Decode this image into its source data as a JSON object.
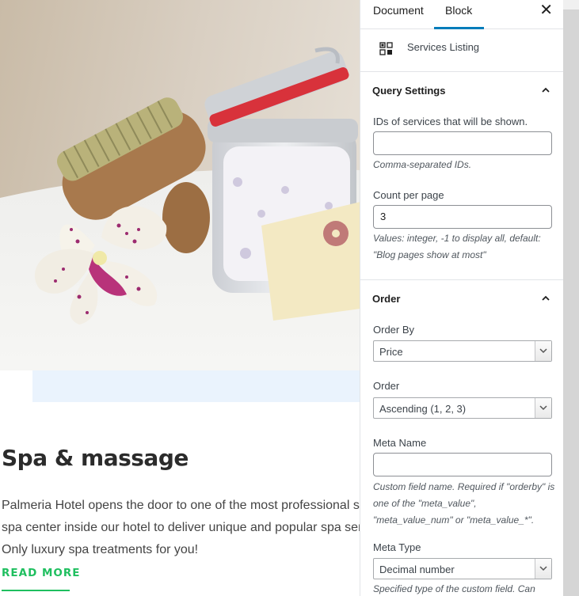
{
  "post": {
    "title": "Spa & massage",
    "lines": [
      "Palmeria Hotel opens the door to one of the most professional s",
      "spa center inside our hotel to deliver unique and popular spa ser",
      "Only luxury spa treatments for you!"
    ],
    "read_more": "READ MORE"
  },
  "sidebar": {
    "tabs": {
      "document": "Document",
      "block": "Block"
    },
    "close_glyph": "✕",
    "block_name": "Services Listing",
    "query": {
      "title": "Query Settings",
      "ids_label": "IDs of services that will be shown.",
      "ids_value": "",
      "ids_help": "Comma-separated IDs.",
      "count_label": "Count per page",
      "count_value": "3",
      "count_help": "Values: integer, -1 to display all, default: \"Blog pages show at most\""
    },
    "order": {
      "title": "Order",
      "order_by_label": "Order By",
      "order_by_value": "Price",
      "order_label": "Order",
      "order_value": "Ascending (1, 2, 3)",
      "meta_name_label": "Meta Name",
      "meta_name_value": "",
      "meta_name_help": "Custom field name. Required if \"orderby\" is one of the \"meta_value\", \"meta_value_num\" or \"meta_value_*\".",
      "meta_type_label": "Meta Type",
      "meta_type_value": "Decimal number",
      "meta_type_help": "Specified type of the custom field. Can"
    }
  },
  "colors": {
    "accent": "#007cba",
    "read_more": "#1fbf5f",
    "highlight_strip": "#eaf3fd"
  }
}
